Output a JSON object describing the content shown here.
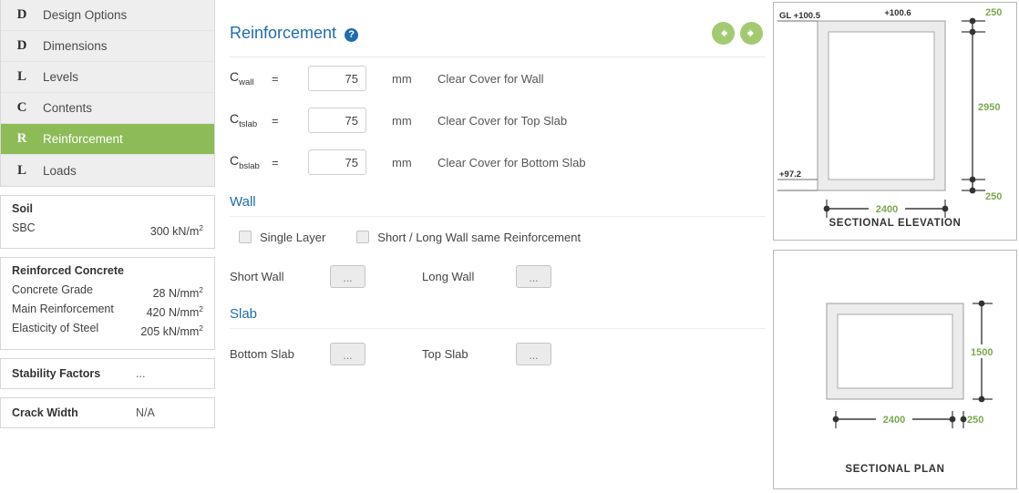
{
  "sidebar": {
    "items": [
      {
        "letter": "D",
        "label": "Design Options",
        "active": false
      },
      {
        "letter": "D",
        "label": "Dimensions",
        "active": false
      },
      {
        "letter": "L",
        "label": "Levels",
        "active": false
      },
      {
        "letter": "C",
        "label": "Contents",
        "active": false
      },
      {
        "letter": "R",
        "label": "Reinforcement",
        "active": true
      },
      {
        "letter": "L",
        "label": "Loads",
        "active": false
      }
    ],
    "soil": {
      "title": "Soil",
      "rows": [
        {
          "label": "SBC",
          "value": "300 kN/m",
          "sup": "2"
        }
      ]
    },
    "concrete": {
      "title": "Reinforced Concrete",
      "rows": [
        {
          "label": "Concrete Grade",
          "value": "28 N/mm",
          "sup": "2"
        },
        {
          "label": "Main Reinforcement",
          "value": "420 N/mm",
          "sup": "2"
        },
        {
          "label": "Elasticity of Steel",
          "value": "205 kN/mm",
          "sup": "2"
        }
      ]
    },
    "stability": {
      "title": "Stability Factors",
      "value": "..."
    },
    "crack": {
      "title": "Crack Width",
      "value": "N/A"
    }
  },
  "main": {
    "title": "Reinforcement",
    "help_icon": "question-mark-icon",
    "prev_label": "←",
    "next_label": "→",
    "cover_rows": [
      {
        "symbol": "C",
        "subscript": "wall",
        "equals": "=",
        "value": "75",
        "unit": "mm",
        "description": "Clear Cover for Wall"
      },
      {
        "symbol": "C",
        "subscript": "tslab",
        "equals": "=",
        "value": "75",
        "unit": "mm",
        "description": "Clear Cover for Top Slab"
      },
      {
        "symbol": "C",
        "subscript": "bslab",
        "equals": "=",
        "value": "75",
        "unit": "mm",
        "description": "Clear Cover for Bottom Slab"
      }
    ],
    "wall": {
      "title": "Wall",
      "checkbox_single_layer": "Single Layer",
      "checkbox_same_reinf": "Short / Long Wall same Reinforcement",
      "short_wall_label": "Short Wall",
      "short_wall_button": "...",
      "long_wall_label": "Long Wall",
      "long_wall_button": "..."
    },
    "slab": {
      "title": "Slab",
      "bottom_slab_label": "Bottom Slab",
      "bottom_slab_button": "...",
      "top_slab_label": "Top Slab",
      "top_slab_button": "..."
    }
  },
  "drawings": {
    "elevation": {
      "caption": "SECTIONAL ELEVATION",
      "ground_level": "GL +100.5",
      "top_level": "+100.6",
      "bottom_level": "+97.2",
      "dim_top": "250",
      "dim_height": "2950",
      "dim_bottom": "250",
      "dim_width": "2400"
    },
    "plan": {
      "caption": "SECTIONAL PLAN",
      "dim_height": "1500",
      "dim_width": "2400",
      "dim_thickness": "250"
    }
  },
  "colors": {
    "accent_green": "#8cbb57",
    "accent_blue": "#1f6cb0",
    "dim_green": "#7aa84f"
  }
}
